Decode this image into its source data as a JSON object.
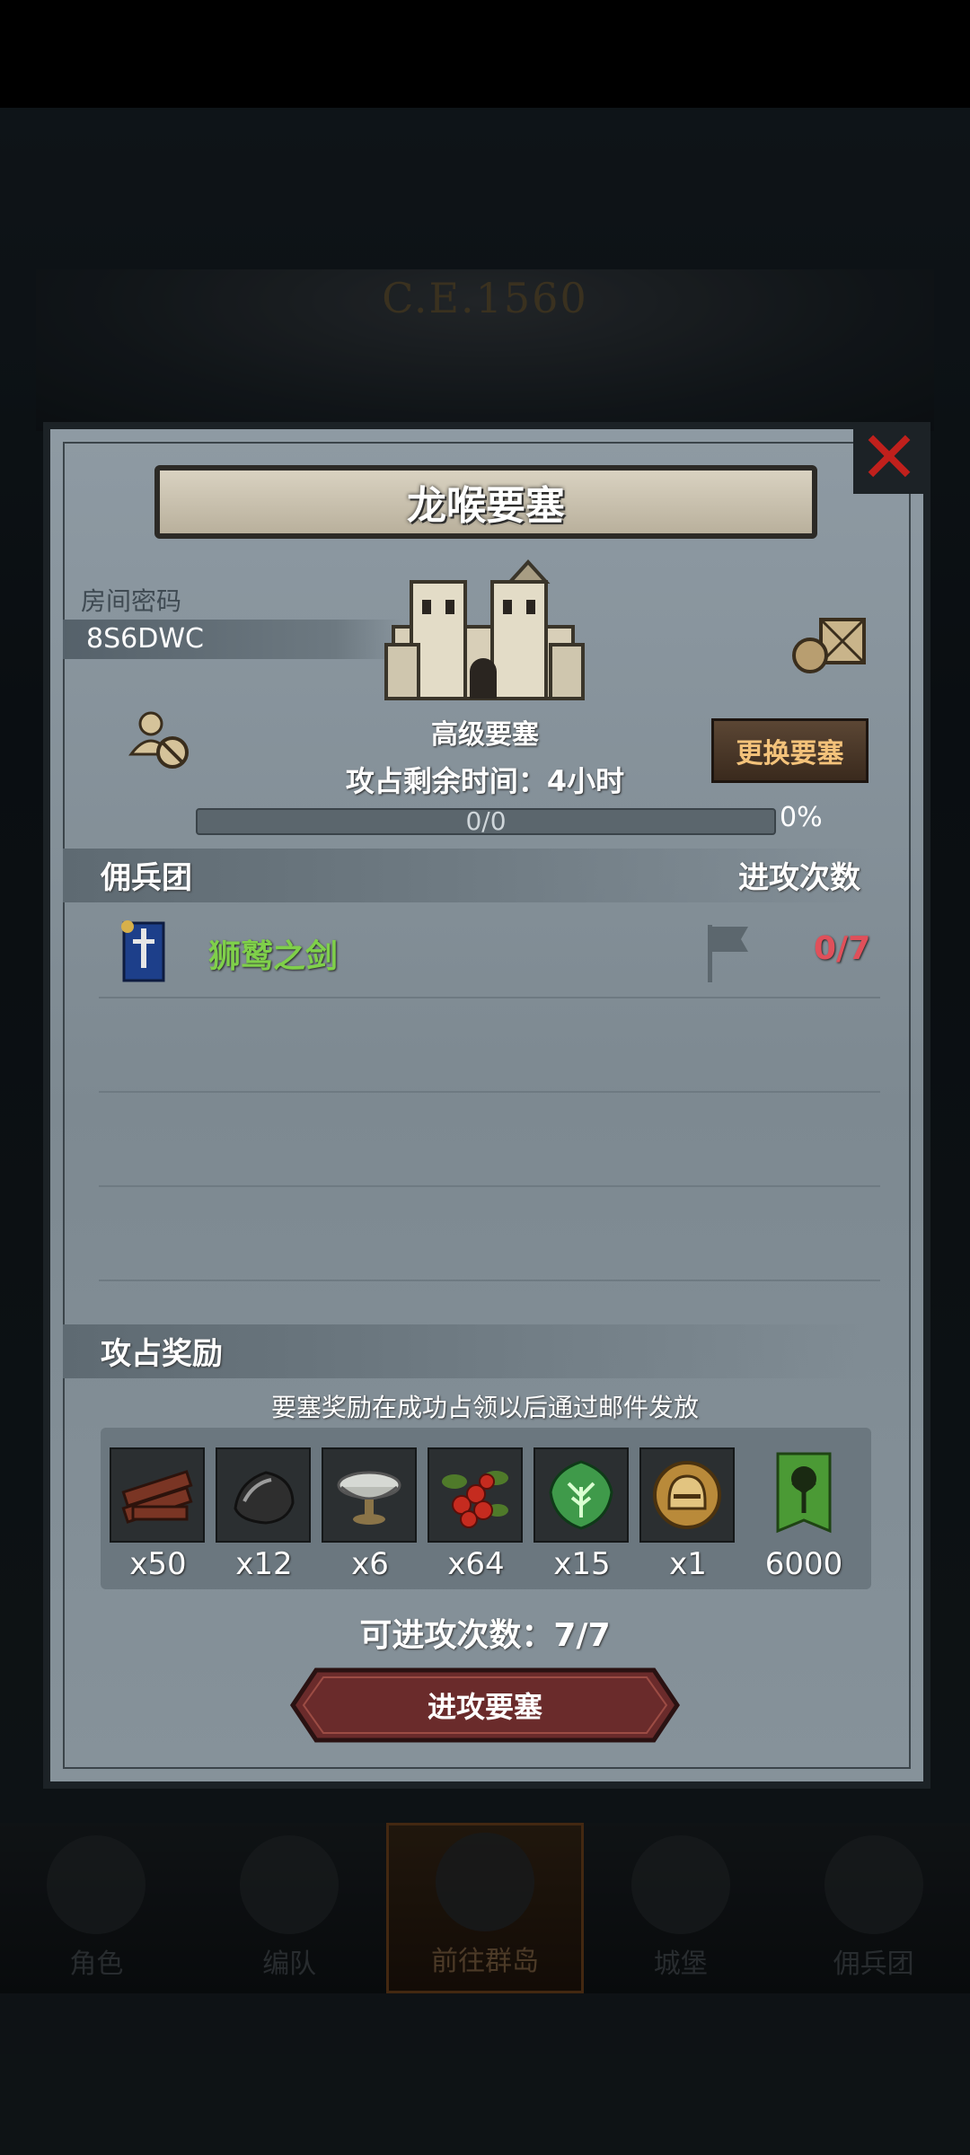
{
  "background": {
    "year": "C.E.1560"
  },
  "dialog": {
    "title": "龙喉要塞",
    "room_label": "房间密码",
    "room_code": "8S6DWC",
    "fortress_level": "高级要塞",
    "change_button": "更换要塞",
    "remaining_time": "攻占剩余时间：4小时",
    "progress": {
      "text": "0/0",
      "percent_label": "0%",
      "fraction": 0
    },
    "mercenary_section": {
      "title": "佣兵团",
      "column_attacks": "进攻次数"
    },
    "mercenaries": [
      {
        "name": "狮鹫之剑",
        "attacks": "0/7"
      }
    ],
    "reward_section": {
      "title": "攻占奖励",
      "note": "要塞奖励在成功占领以后通过邮件发放",
      "items": [
        {
          "icon": "wood-planks-icon",
          "qty": "x50"
        },
        {
          "icon": "ore-icon",
          "qty": "x12"
        },
        {
          "icon": "silver-bowl-icon",
          "qty": "x6"
        },
        {
          "icon": "berries-icon",
          "qty": "x64"
        },
        {
          "icon": "green-tree-crest-icon",
          "qty": "x15"
        },
        {
          "icon": "knight-helmet-icon",
          "qty": "x1"
        },
        {
          "icon": "tree-banner-icon",
          "qty": "6000"
        }
      ]
    },
    "attempts": "可进攻次数：7/7",
    "attack_button": "进攻要塞"
  },
  "nav": [
    {
      "label": "角色"
    },
    {
      "label": "编队"
    },
    {
      "label": "前往群岛",
      "active": true
    },
    {
      "label": "城堡"
    },
    {
      "label": "佣兵团"
    }
  ],
  "colors": {
    "accent": "#f3c27a",
    "mercenary_name": "#7fd04a",
    "attack_count": "#e0505a",
    "close": "#c0201c"
  }
}
